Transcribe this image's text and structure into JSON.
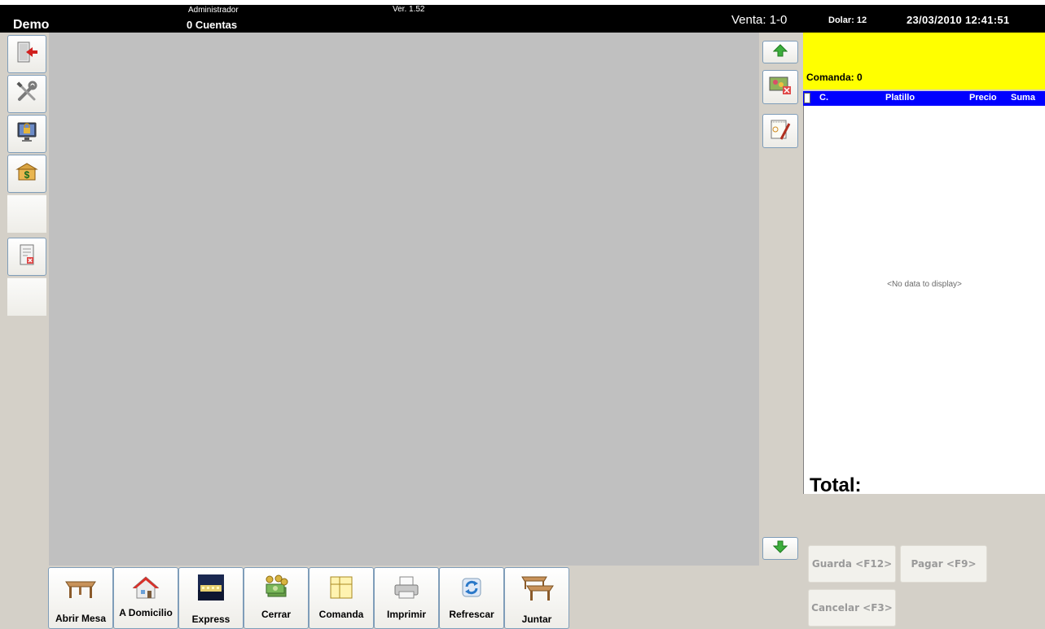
{
  "topbar": {
    "app_name": "Demo",
    "user": "Administrador",
    "accounts": "0 Cuentas",
    "version": "Ver. 1.52",
    "venta": "Venta: 1-0",
    "dolar": "Dolar: 12",
    "datetime": "23/03/2010 12:41:51"
  },
  "left_toolbar": {
    "icons": [
      "exit-door-icon",
      "tools-icon",
      "lock-screen-icon",
      "cash-box-icon",
      "report-cancel-icon"
    ]
  },
  "right_tools": {
    "icons": [
      "arrow-up-icon",
      "picture-cancel-icon",
      "notepad-edit-icon",
      "arrow-down-icon"
    ]
  },
  "order": {
    "comanda_label": "Comanda: 0",
    "columns": [
      "C.",
      "Platillo",
      "Precio",
      "Suma"
    ],
    "empty_text": "<No data to display>",
    "total_label": "Total:"
  },
  "actions": {
    "guarda": "Guarda <F12>",
    "pagar": "Pagar <F9>",
    "cancelar": "Cancelar <F3>"
  },
  "bottom_buttons": [
    {
      "label": "Abrir Mesa",
      "icon": "table-icon"
    },
    {
      "label": "A Domicilio",
      "icon": "house-icon"
    },
    {
      "label": "Express",
      "icon": "train-icon"
    },
    {
      "label": "Cerrar",
      "icon": "money-icon"
    },
    {
      "label": "Comanda",
      "icon": "order-sheet-icon"
    },
    {
      "label": "Imprimir",
      "icon": "printer-icon"
    },
    {
      "label": "Refrescar",
      "icon": "refresh-icon"
    },
    {
      "label": "Juntar",
      "icon": "join-tables-icon"
    }
  ],
  "colors": {
    "order_header_bg": "#ffff00",
    "grid_header_bg": "#0000ff",
    "canvas_bg": "#c0c0c0",
    "panel_bg": "#d4d0c8"
  }
}
